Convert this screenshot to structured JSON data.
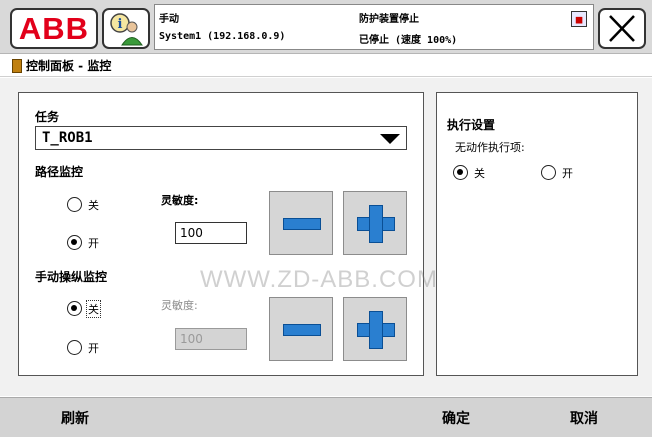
{
  "topbar": {
    "logo_text": "ABB",
    "mode": "手动",
    "system": "System1 (192.168.0.9)",
    "safety_status": "防护装置停止",
    "run_status": "已停止 (速度 100%)"
  },
  "title": "控制面板 - 监控",
  "task": {
    "label": "任务",
    "value": "T_ROB1"
  },
  "path_supervision": {
    "heading": "路径监控",
    "off_label": "关",
    "on_label": "开",
    "selected": "on",
    "sensitivity_label": "灵敏度:",
    "sensitivity_value": "100"
  },
  "jog_supervision": {
    "heading": "手动操纵监控",
    "off_label": "关",
    "on_label": "开",
    "selected": "off",
    "sensitivity_label": "灵敏度:",
    "sensitivity_value": "100"
  },
  "execution_settings": {
    "heading": "执行设置",
    "no_motion_label": "无动作执行项:",
    "off_label": "关",
    "on_label": "开",
    "selected": "off"
  },
  "watermark": "WWW.ZD-ABB.COM",
  "bottom": {
    "refresh": "刷新",
    "ok": "确定",
    "cancel": "取消"
  },
  "colors": {
    "abb_red": "#e2001a",
    "plus_minus_blue": "#2a7fd0",
    "panel_bg": "#f1f1f1",
    "bar_gray": "#d3d3d3"
  },
  "icons": {
    "abb_menu": "abb-logo-icon",
    "quickset": "quickset-person-icon",
    "event_log": "event-log-icon",
    "close": "close-x-icon",
    "control_panel": "control-panel-icon",
    "minus": "minus-icon",
    "plus": "plus-icon",
    "dropdown": "dropdown-arrow-icon"
  }
}
